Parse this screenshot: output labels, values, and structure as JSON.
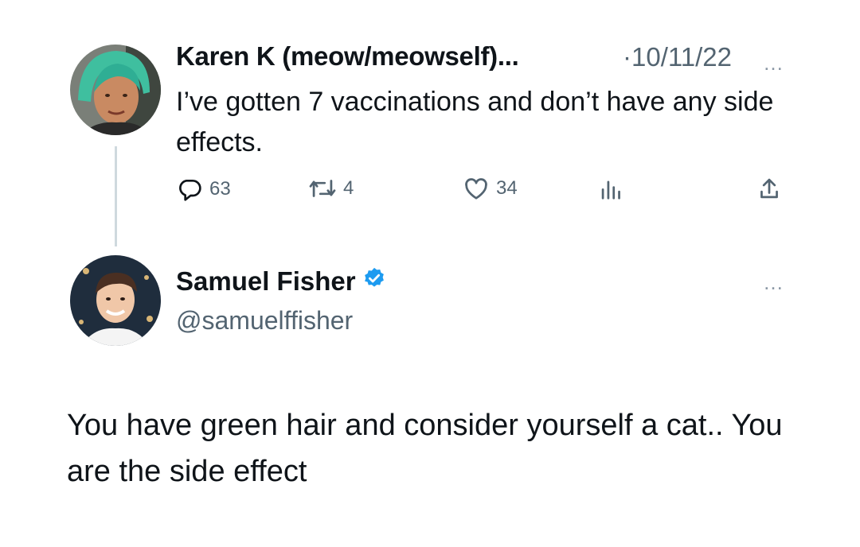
{
  "original_tweet": {
    "display_name": "Karen K (meow/meowself)...",
    "separator": "·",
    "date": "10/11/22",
    "text": "I’ve gotten 7 vaccinations and don’t have any side effects.",
    "more_icon": "…",
    "actions": {
      "replies": "63",
      "retweets": "4",
      "likes": "34"
    }
  },
  "reply_tweet": {
    "display_name": "Samuel Fisher",
    "handle": "@samuelffisher",
    "more_icon": "…",
    "text": "You have green hair and consider yourself a cat.. You are the side effect"
  },
  "colors": {
    "text": "#0f1419",
    "secondary": "#536471",
    "verified": "#1d9bf0",
    "thread_line": "#cfd9de"
  }
}
